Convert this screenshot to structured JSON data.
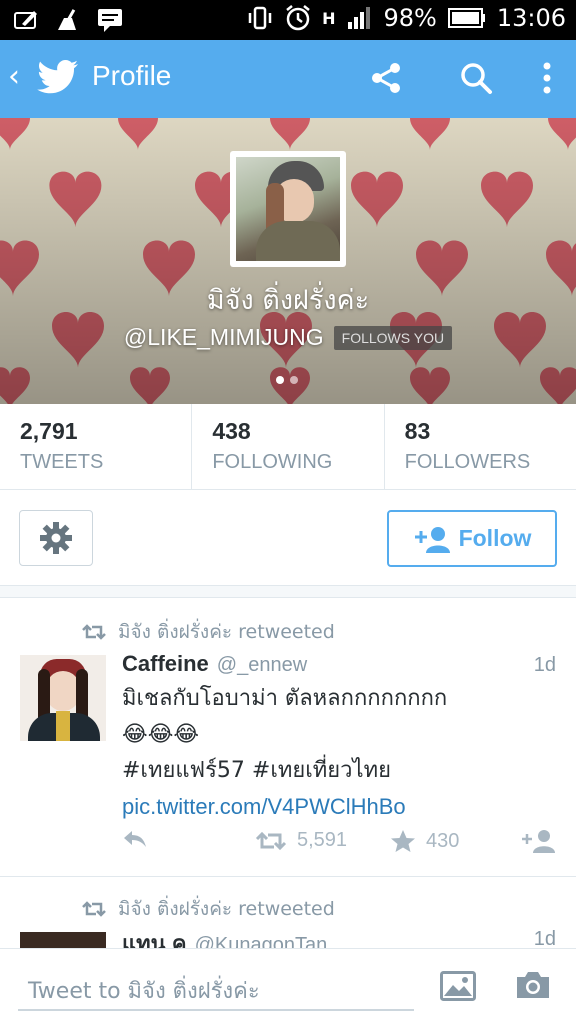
{
  "status_bar": {
    "battery": "98%",
    "time": "13:06",
    "network": "H"
  },
  "action_bar": {
    "title": "Profile",
    "accent": "#55acee"
  },
  "profile": {
    "display_name": "มิจัง ติ่งฝรั่งค่ะ",
    "handle": "@LIKE_MIMIJUNG",
    "follows_you": "FOLLOWS YOU"
  },
  "stats": [
    {
      "value": "2,791",
      "label": "TWEETS"
    },
    {
      "value": "438",
      "label": "FOLLOWING"
    },
    {
      "value": "83",
      "label": "FOLLOWERS"
    }
  ],
  "follow_button": {
    "label": "Follow"
  },
  "tweets": [
    {
      "retweeted_by": "มิจัง ติ่งฝรั่งค่ะ retweeted",
      "name": "Caffeine",
      "handle": "@_ennew",
      "time": "1d",
      "text_line1": "มิเชลกับโอบาม่า ตัลหลกกกกกกกก",
      "emoji": "😂😂😂",
      "hashtags": "#เทยแฟร์57 #เทยเที่ยวไทย",
      "link": "pic.twitter.com/V4PWClHhBo",
      "retweets": "5,591",
      "favorites": "430"
    },
    {
      "retweeted_by": "มิจัง ติ่งฝรั่งค่ะ retweeted",
      "name": "แทน ค",
      "handle": "@KunagonTan",
      "time": "1d"
    }
  ],
  "composer": {
    "placeholder": "Tweet to มิจัง ติ่งฝรั่งค่ะ"
  }
}
